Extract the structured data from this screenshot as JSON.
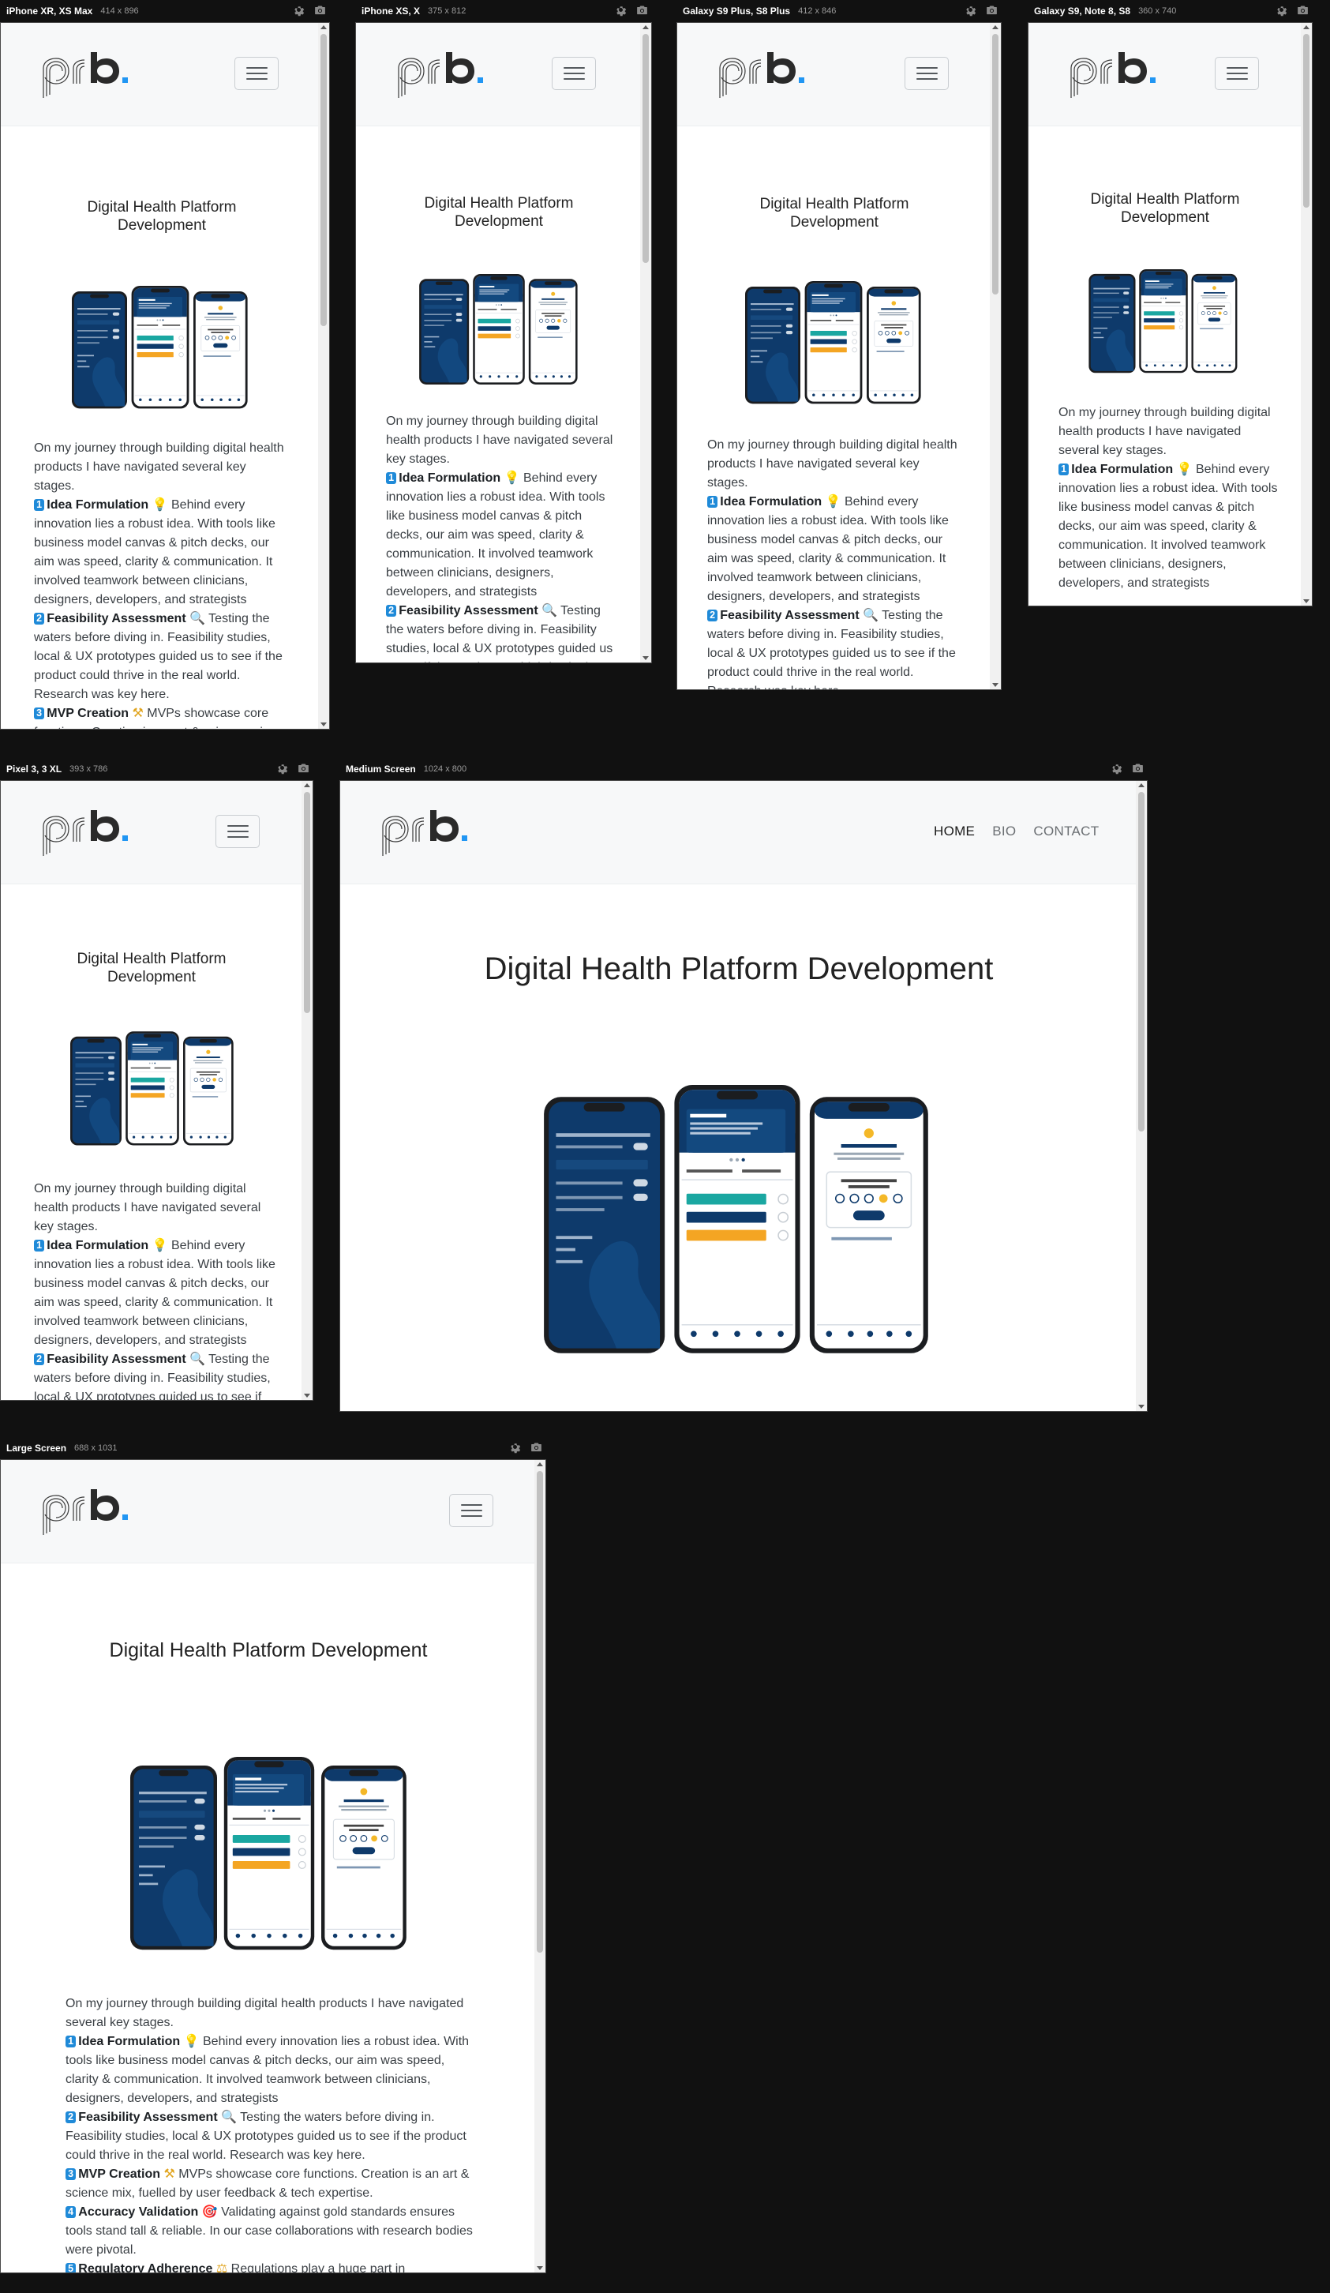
{
  "toolbar": {
    "settings_icon": "gear-icon",
    "screenshot_icon": "camera-icon"
  },
  "devices": [
    {
      "name": "iPhone XR, XS Max",
      "size": "414 x 896"
    },
    {
      "name": "iPhone XS, X",
      "size": "375 x 812"
    },
    {
      "name": "Galaxy S9 Plus, S8 Plus",
      "size": "412 x 846"
    },
    {
      "name": "Galaxy S9, Note 8, S8",
      "size": "360 x 740"
    },
    {
      "name": "Pixel 3, 3 XL",
      "size": "393 x 786"
    },
    {
      "name": "Medium Screen",
      "size": "1024 x 800"
    },
    {
      "name": "Large Screen",
      "size": "688 x 1031"
    }
  ],
  "site": {
    "logo_text": "prb.",
    "nav": {
      "home": "HOME",
      "bio": "BIO",
      "contact": "CONTACT"
    },
    "page_title": "Digital Health Platform Development",
    "intro": "On my journey through building digital health products I have navigated several key stages.",
    "stages": [
      {
        "num": "1",
        "title": "Idea Formulation",
        "emoji": "💡",
        "text": "Behind every innovation lies a robust idea. With tools like business model canvas & pitch decks, our aim was speed, clarity & communication. It involved teamwork between clinicians, designers, developers, and strategists"
      },
      {
        "num": "2",
        "title": "Feasibility Assessment",
        "emoji": "🔍",
        "text": "Testing the waters before diving in. Feasibility studies, local & UX prototypes guided us to see if the product could thrive in the real world. Research was key here."
      },
      {
        "num": "3",
        "title": "MVP Creation",
        "emoji": "⚒",
        "text": "MVPs showcase core functions. Creation is an art & science mix, fuelled by user feedback & tech expertise."
      },
      {
        "num": "4",
        "title": "Accuracy Validation",
        "emoji": "🎯",
        "text": "Validating against gold standards ensures tools stand tall & reliable. In our case collaborations with research bodies were pivotal."
      },
      {
        "num": "5",
        "title": "Regulatory Adherence",
        "emoji": "⚖",
        "text": "Regulations play a huge part in"
      }
    ]
  },
  "app_screens": {
    "left": {
      "settings_title": "Notification preferences",
      "rows": [
        "Daily comfort level reminder",
        "Time",
        "Daily mobility phone reminder",
        "Weekly exercise reminder",
        "Every Wednesday 19:00"
      ],
      "time_value": "18:30",
      "links": [
        "Privacy Policy",
        "Help",
        "Log out"
      ]
    },
    "center": {
      "card_title": "Recovery Hub",
      "card_text": "Keep track of your progress, keep your clinical team informed and receive personalised guidance on recovery exercises.",
      "tabs": [
        "Daily checklist",
        "My progress"
      ],
      "tasks": [
        "Complete my exercises",
        "Take mobility phone",
        "Rate comfort level"
      ],
      "nav": [
        "Home",
        "Education",
        "Results",
        "Book a visit",
        "Settings"
      ]
    },
    "right": {
      "title": "Rate your comfort level",
      "subtitle": "Let us and your clinical team know how you're feeling and track your progress over the course of your recovery.",
      "question": "How would you rate your comfort level today?",
      "button": "Update",
      "last_logged": "Last logged: 16/10/2023"
    }
  },
  "colors": {
    "app_navy": "#0e3a6b",
    "app_teal": "#1aa7a1",
    "app_amber": "#f4a523",
    "badge_blue": "#1f8ad8",
    "logo_dark": "#2a2a2a",
    "logo_accent": "#2196f3"
  }
}
